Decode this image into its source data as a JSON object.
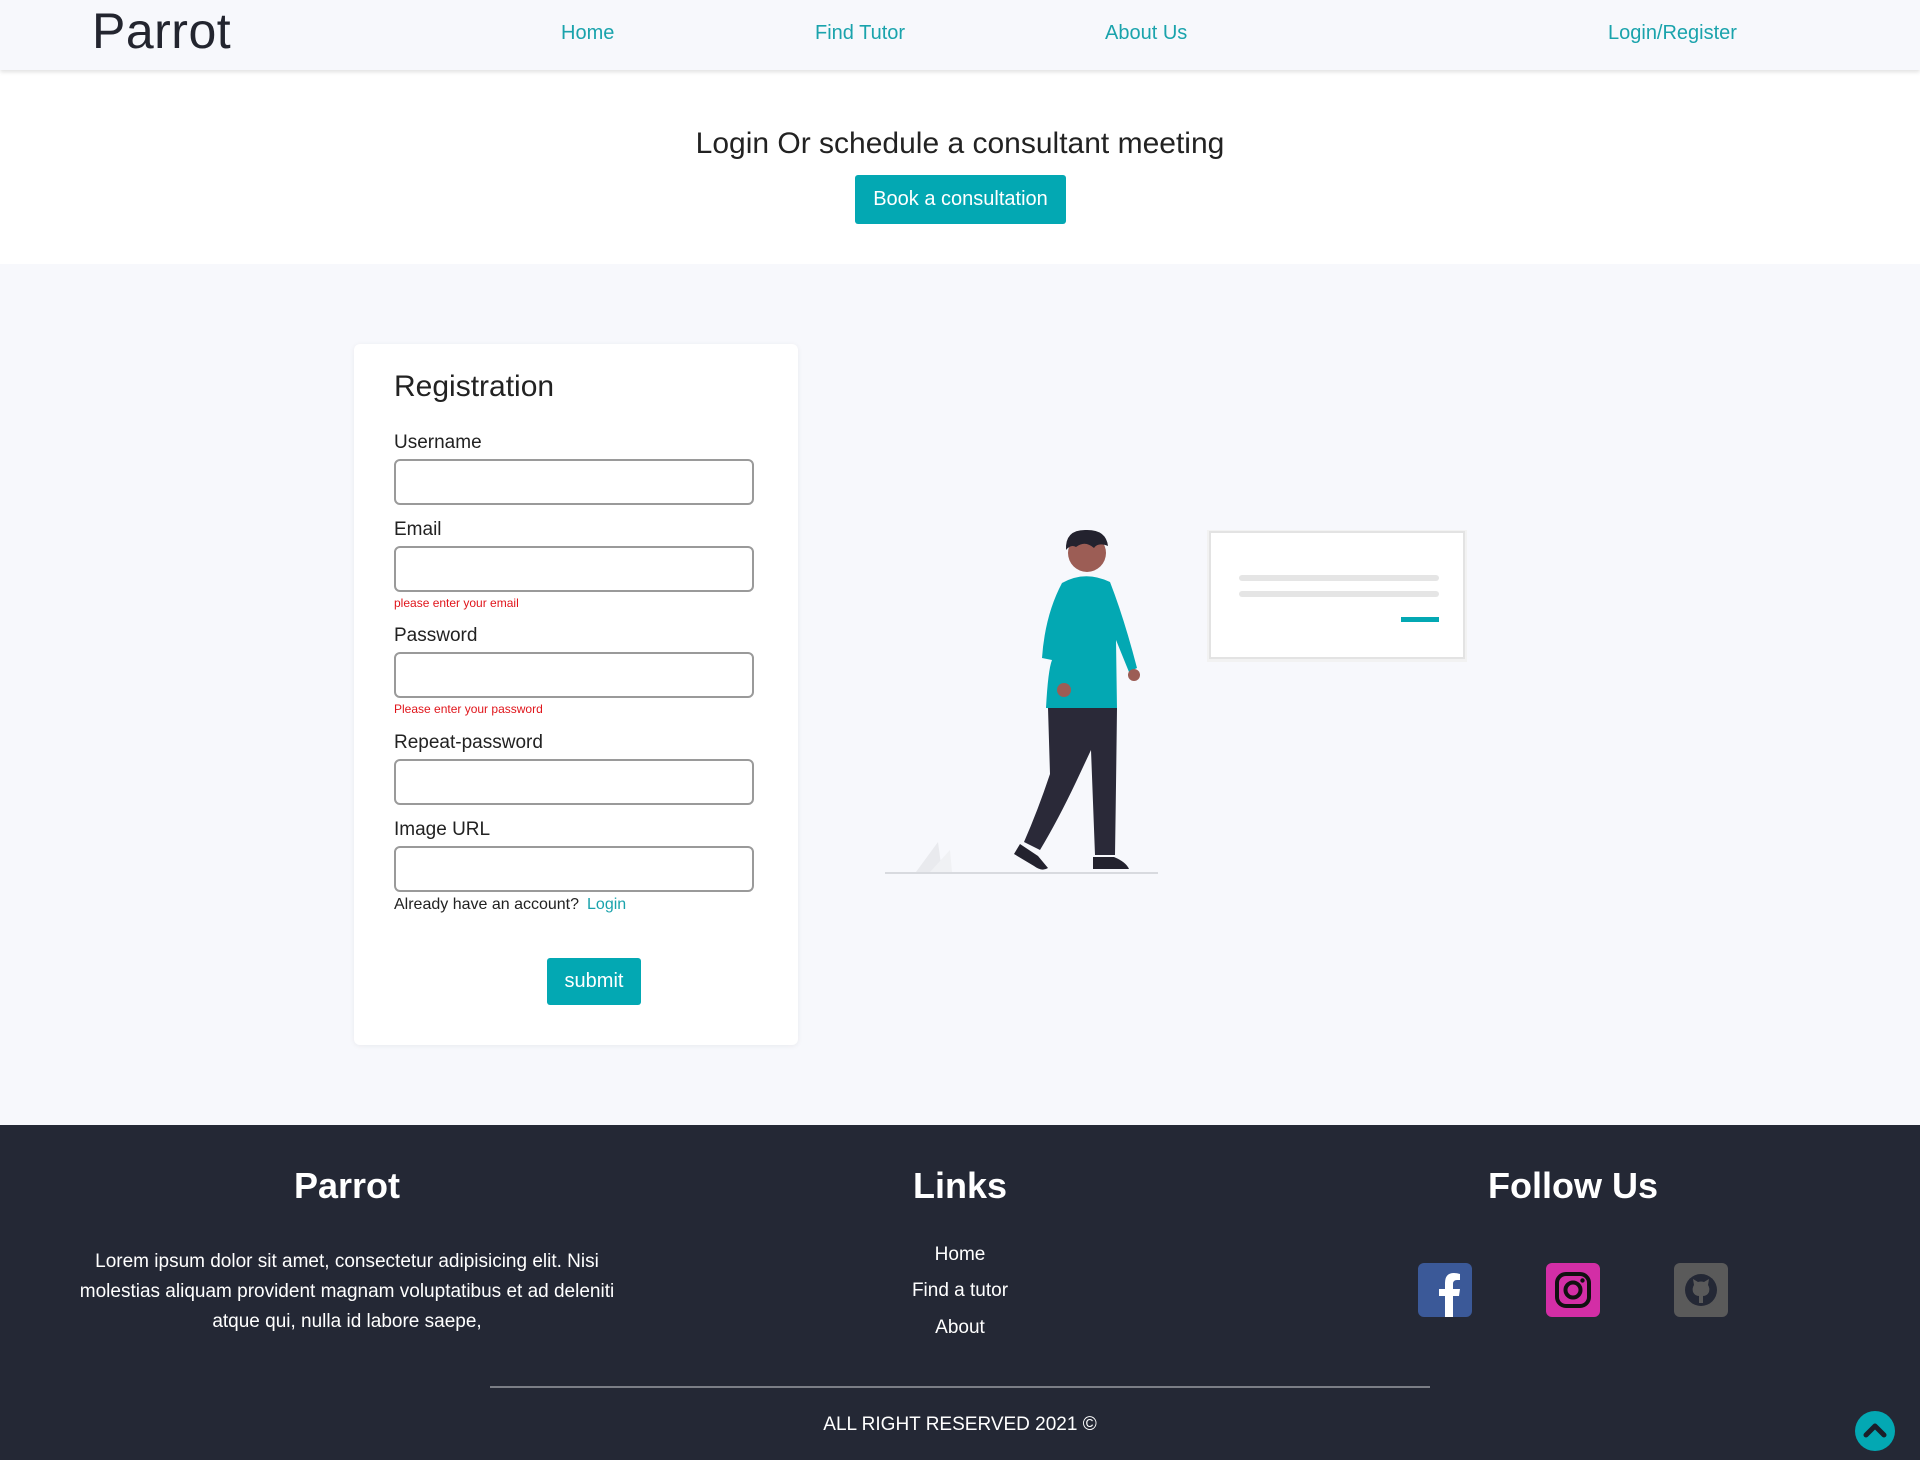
{
  "nav": {
    "brand": "Parrot",
    "links": [
      "Home",
      "Find Tutor",
      "About Us",
      "Login/Register"
    ]
  },
  "hero": {
    "title": "Login Or schedule a consultant meeting",
    "button": "Book a consultation"
  },
  "registration": {
    "title": "Registration",
    "fields": [
      {
        "label": "Username",
        "value": "",
        "error": ""
      },
      {
        "label": "Email",
        "value": "",
        "error": "please enter your email"
      },
      {
        "label": "Password",
        "value": "",
        "error": "Please enter your password"
      },
      {
        "label": "Repeat-password",
        "value": "",
        "error": ""
      },
      {
        "label": "Image URL",
        "value": "",
        "error": ""
      }
    ],
    "have_account": "Already have an account?",
    "login_link": "Login",
    "submit": "submit"
  },
  "footer": {
    "brand": "Parrot",
    "description": "Lorem ipsum dolor sit amet, consectetur adipisicing elit. Nisi molestias aliquam provident magnam voluptatibus et ad deleniti atque qui, nulla id labore saepe,",
    "links_heading": "Links",
    "links": [
      "Home",
      "Find a tutor",
      "About"
    ],
    "follow_heading": "Follow Us",
    "social": [
      {
        "icon": "facebook-icon",
        "color": "#3b5998"
      },
      {
        "icon": "instagram-icon",
        "color": "#d32ea6"
      },
      {
        "icon": "github-icon",
        "color": "#5a5a5a"
      }
    ],
    "copyright": "ALL RIGHT RESERVED 2021 ©"
  },
  "colors": {
    "accent": "#03a8b3",
    "link": "#1aa3ac",
    "error": "#e0151b",
    "footer_bg": "#242835",
    "page_bg": "#f7f8fc"
  }
}
